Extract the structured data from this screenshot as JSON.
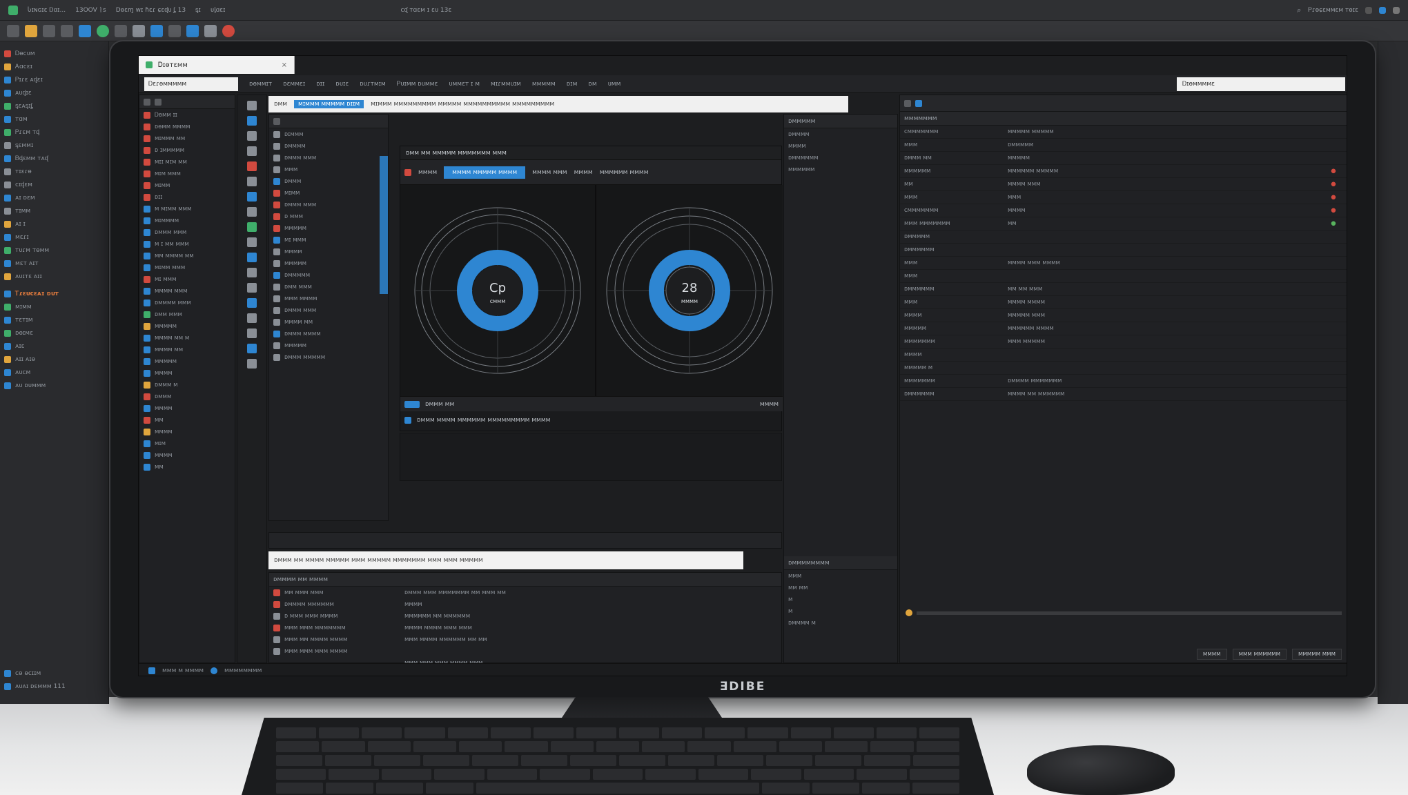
{
  "host": {
    "titlebar_items": [
      "Ⴑɪɴɢɪɛ Ꭰɑɪ...",
      "13OOV ᚱs",
      "Dɵɛɱ ᴡɪ ɦɛɾ ɕɛᶑᴜ ᶋ 13",
      "ᶊɪ",
      "ᴜᶅɑɛɪ",
      "ᴄᶑ ᴛɑɛᴍ ɪ ɛᴜ 13ɛ"
    ],
    "titlebar_right": "Ꮲɾɵɕɛᴍᴍɛᴍ ᴛɵɪɛ",
    "left_items": [
      {
        "label": "Ꭰɵᴄᴜᴍ",
        "color": "#d24a3f"
      },
      {
        "label": "Ꭺɑᴄɛɪ",
        "color": "#e0a53d"
      },
      {
        "label": "Ꮲɪɾɛ ᴀᶁɛɪ",
        "color": "#2e86d2"
      },
      {
        "label": "ᴀᴜᶁɪɛ",
        "color": "#2e86d2"
      },
      {
        "label": "ᶊɛᴀᶊɪᶋ",
        "color": "#3fae6a"
      },
      {
        "label": "ᴛɑᴍ",
        "color": "#2e86d2"
      },
      {
        "label": "Ꮲɾɛᴍ ᴛᶁ",
        "color": "#3fae6a"
      },
      {
        "label": "ᶊɛᴍᴍɪ",
        "color": "#8a8f96"
      },
      {
        "label": "Ᏼᶁɛᴍᴍ ᴛᴀᶑ",
        "color": "#2e86d2"
      },
      {
        "label": "ᴛɪɛɾɵ",
        "color": "#8a8f96"
      },
      {
        "label": "ᴄɪᶁɛᴍ",
        "color": "#8a8f96"
      },
      {
        "label": "ᴀɪ ᴅɛᴍ",
        "color": "#2e86d2"
      },
      {
        "label": "ᴛɪᴍᴍ",
        "color": "#8a8f96"
      },
      {
        "label": "ᴀɪ ɪ",
        "color": "#e0a53d"
      },
      {
        "label": "ᴍɛɾɪ",
        "color": "#2e86d2"
      },
      {
        "label": "ᴛᴜɾᴍ ᴛɵᴍᴍ",
        "color": "#3fae6a"
      },
      {
        "label": "ᴍɛᴛ ᴀɪᴛ",
        "color": "#2e86d2"
      },
      {
        "label": "ᴀᴜɪᴛɛ ᴀɪɪ",
        "color": "#e0a53d"
      }
    ],
    "left_section": "Ꭲɾɛᴜᴄɛᴀɪ ᴅᴜᴛ",
    "left_items_2": [
      {
        "label": "ᴍɪᴍᴍ",
        "color": "#3fae6a"
      },
      {
        "label": "ᴛɛᴛɪᴍ",
        "color": "#2e86d2"
      },
      {
        "label": "ᴅɵɪᴍɛ",
        "color": "#3fae6a"
      },
      {
        "label": "ᴀɪɛ",
        "color": "#2e86d2"
      },
      {
        "label": "ᴀɪɪ ᴀɪɵ",
        "color": "#e0a53d"
      },
      {
        "label": "ᴀᴜᴄᴍ",
        "color": "#2e86d2"
      },
      {
        "label": "ᴀᴜ ᴅᴜᴍᴍᴍ",
        "color": "#2e86d2"
      }
    ],
    "left_bottom": [
      "ᴄɵ ɵᴄɪɪᴍ",
      "ᴀᴜᴀɪ ᴅɛᴍᴍᴍ 111"
    ]
  },
  "app": {
    "title": "Ꭰɪɵᴛɛᴍᴍ",
    "menu": [
      "ᴅɵᴍᴍɪᴛ",
      "ᴅɛᴍᴍɛɪ",
      "ᴅɪɪ",
      "ᴅᴜɪɛ",
      "ᴅᴜɾᴛᴍɪᴍ",
      "Ꮲᴜɪᴍᴍ ᴅᴜᴍᴍɛ",
      "ᴜᴍᴍɛᴛ ɪ ᴍ",
      "ᴍɪɾᴍᴍᴜɪᴍ",
      "ᴍᴍᴍᴍᴍ",
      "ᴅɪᴍ",
      "ᴅᴍ",
      "ᴜᴍᴍ"
    ],
    "search_a_value": "Ꭰɛɾɵᴍᴍᴍᴍᴍ",
    "search_b_value": "Ꭰɪɵᴍᴍᴍᴍɛ",
    "top_url": {
      "prefix": "ᴅᴍᴍ",
      "selected": "ᴍɪᴍᴍᴍ ᴍᴍᴍᴍᴍ ᴅɪɪᴍ",
      "rest": "ᴍɪᴍᴍᴍ ᴍᴍᴍᴍᴍᴍᴍᴍᴍ ᴍᴍᴍᴍᴍ ᴍᴍᴍᴍᴍᴍᴍᴍᴍᴍ ᴍᴍᴍᴍᴍᴍᴍᴍᴍ"
    },
    "project_items": [
      {
        "label": "Ꭰɵᴍᴍ ɪɪ",
        "color": "#d24a3f"
      },
      {
        "label": "ᴅɵᴍᴍ ᴍᴍᴍᴍ",
        "color": "#d24a3f"
      },
      {
        "label": "ᴍɪᴍᴍᴍ ᴍᴍ",
        "color": "#d24a3f"
      },
      {
        "label": "ᴅ ɪᴍᴍᴍᴍᴍ",
        "color": "#d24a3f"
      },
      {
        "label": "ᴍɪɪ ᴍɪᴍ ᴍᴍ",
        "color": "#d24a3f"
      },
      {
        "label": "ᴍɪᴍ ᴍᴍᴍ",
        "color": "#d24a3f"
      },
      {
        "label": "ᴍɪᴍᴍ",
        "color": "#d24a3f"
      },
      {
        "label": "ᴅɪɪ",
        "color": "#d24a3f"
      },
      {
        "label": "ᴍ ᴍɪᴍᴍ ᴍᴍᴍ",
        "color": "#2e86d2"
      },
      {
        "label": "ᴍɪᴍᴍᴍᴍ",
        "color": "#2e86d2"
      },
      {
        "label": "ᴅᴍᴍᴍ ᴍᴍᴍ",
        "color": "#2e86d2"
      },
      {
        "label": "ᴍ ɪ ᴍᴍ ᴍᴍᴍ",
        "color": "#2e86d2"
      },
      {
        "label": "ᴍᴍ ᴍᴍᴍᴍ ᴍᴍ",
        "color": "#2e86d2"
      },
      {
        "label": "ᴍɪᴍᴍ ᴍᴍᴍ",
        "color": "#2e86d2"
      },
      {
        "label": "ᴍɪ ᴍᴍᴍ",
        "color": "#d24a3f"
      },
      {
        "label": "ᴍᴍᴍᴍ ᴍᴍᴍ",
        "color": "#2e86d2"
      },
      {
        "label": "ᴅᴍᴍᴍᴍ ᴍᴍᴍ",
        "color": "#2e86d2"
      },
      {
        "label": "ᴅᴍᴍ ᴍᴍᴍ",
        "color": "#3fae6a"
      },
      {
        "label": "ᴍᴍᴍᴍᴍ",
        "color": "#e0a53d"
      },
      {
        "label": "ᴍᴍᴍᴍ ᴍᴍ ᴍ",
        "color": "#2e86d2"
      },
      {
        "label": "ᴍᴍᴍᴍ ᴍᴍ",
        "color": "#2e86d2"
      },
      {
        "label": "ᴍᴍᴍᴍᴍ",
        "color": "#2e86d2"
      },
      {
        "label": "ᴍᴍᴍᴍ",
        "color": "#2e86d2"
      },
      {
        "label": "ᴅᴍᴍᴍ ᴍ",
        "color": "#e0a53d"
      },
      {
        "label": "ᴅᴍᴍᴍ",
        "color": "#d24a3f"
      },
      {
        "label": "ᴍᴍᴍᴍ",
        "color": "#2e86d2"
      },
      {
        "label": "ᴍᴍ",
        "color": "#d24a3f"
      },
      {
        "label": "ᴍᴍᴍᴍ",
        "color": "#e0a53d"
      },
      {
        "label": "ᴍɪᴍ",
        "color": "#2e86d2"
      },
      {
        "label": "ᴍᴍᴍᴍ",
        "color": "#2e86d2"
      },
      {
        "label": "ᴍᴍ",
        "color": "#2e86d2"
      }
    ],
    "layers_items": [
      {
        "label": "ᴅɪᴍᴍᴍ",
        "color": "#8a8f96"
      },
      {
        "label": "ᴅᴍᴍᴍᴍ",
        "color": "#8a8f96"
      },
      {
        "label": "ᴅᴍᴍᴍ ᴍᴍᴍ",
        "color": "#8a8f96"
      },
      {
        "label": "ᴍᴍᴍ",
        "color": "#8a8f96"
      },
      {
        "label": "ᴅᴍᴍᴍ",
        "color": "#2e86d2"
      },
      {
        "label": "ᴍɪᴍᴍ",
        "color": "#d24a3f"
      },
      {
        "label": "ᴅᴍᴍᴍ ᴍᴍᴍ",
        "color": "#d24a3f"
      },
      {
        "label": "ᴅ ᴍᴍᴍ",
        "color": "#d24a3f"
      },
      {
        "label": "ᴍᴍᴍᴍᴍ",
        "color": "#d24a3f"
      },
      {
        "label": "ᴍɪ ᴍᴍᴍ",
        "color": "#2e86d2"
      },
      {
        "label": "ᴍᴍᴍᴍ",
        "color": "#8a8f96"
      },
      {
        "label": "ᴍᴍᴍᴍᴍ",
        "color": "#8a8f96"
      },
      {
        "label": "ᴅᴍᴍᴍᴍᴍ",
        "color": "#2e86d2"
      },
      {
        "label": "ᴅᴍᴍ ᴍᴍᴍ",
        "color": "#8a8f96"
      },
      {
        "label": "ᴍᴍᴍ ᴍᴍᴍᴍ",
        "color": "#8a8f96"
      },
      {
        "label": "ᴅᴍᴍᴍ ᴍᴍᴍ",
        "color": "#8a8f96"
      },
      {
        "label": "ᴍᴍᴍᴍ ᴍᴍ",
        "color": "#8a8f96"
      },
      {
        "label": "ᴅᴍᴍᴍ ᴍᴍᴍᴍ",
        "color": "#2e86d2"
      },
      {
        "label": "ᴍᴍᴍᴍᴍ",
        "color": "#8a8f96"
      },
      {
        "label": "ᴅᴍᴍᴍ ᴍᴍᴍᴍᴍ",
        "color": "#8a8f96"
      }
    ],
    "viewer": {
      "header": "ᴅᴍᴍ ᴍᴍ ᴍᴍᴍᴍᴍ ᴍᴍᴍᴍᴍᴍᴍ ᴍᴍᴍ",
      "tab_label": "ᴍᴍᴍᴍ",
      "tab_active": "ᴍᴍᴍᴍ ᴍᴍᴍᴍᴍ ᴍᴍᴍᴍ",
      "tabs_rest": [
        "ᴍᴍᴍᴍ ᴍᴍᴍ",
        "ᴍᴍᴍᴍ",
        "ᴍᴍᴍᴍᴍᴍ ᴍᴍᴍᴍ"
      ],
      "gauge_left": {
        "main": "Cp",
        "sub": "ᴄᴍᴍᴍ"
      },
      "gauge_right": {
        "main": "28",
        "sub": "ᴍᴍᴍᴍ"
      },
      "footer_label": "ᴅᴍᴍᴍ ᴍᴍ",
      "footer_right": "ᴍᴍᴍᴍ",
      "timeline_label": "ᴅᴍᴍᴍ ᴍᴍᴍᴍ ᴍᴍᴍᴍᴍᴍ ᴍᴍᴍᴍᴍᴍᴍᴍᴍ ᴍᴍᴍᴍ"
    },
    "bottom_url": "ᴅᴍᴍᴍ ᴍᴍ ᴍᴍᴍᴍ ᴍᴍᴍᴍᴍ ᴍᴍᴍ ᴍᴍᴍᴍᴍ ᴍᴍᴍᴍᴍᴍᴍ ᴍᴍᴍ ᴍᴍᴍ ᴍᴍᴍᴍᴍ",
    "console_title": "ᴅᴍᴍᴍᴍ ᴍᴍ ᴍᴍᴍᴍ",
    "console_lines": [
      "ᴅᴍᴍᴍ ᴍᴍᴍ ᴍᴍᴍᴍᴍᴍᴍ ᴍᴍ ᴍᴍᴍ ᴍᴍ",
      "ᴍᴍᴍᴍ",
      "ᴍᴍᴍᴍᴍᴍ ᴍᴍ ᴍᴍᴍᴍᴍᴍ",
      "ᴍᴍᴍᴍ ᴍᴍᴍᴍ ᴍᴍᴍ ᴍᴍᴍ",
      "ᴍᴍᴍ ᴍᴍᴍᴍ ᴍᴍᴍᴍᴍᴍ ᴍᴍ ᴍᴍ",
      "",
      "ᴍᴍᴍ ᴍᴍᴍ ᴍᴍᴍ ᴍᴍᴍᴍ ᴍᴍᴍ"
    ],
    "console_list": [
      {
        "label": "ᴍᴍ ᴍᴍᴍ ᴍᴍᴍ",
        "color": "#d24a3f"
      },
      {
        "label": "ᴅᴍᴍᴍᴍ ᴍᴍᴍᴍᴍᴍ",
        "color": "#d24a3f"
      },
      {
        "label": "ᴅ ᴍᴍᴍ ᴍᴍᴍ ᴍᴍᴍᴍ",
        "color": "#8a8f96"
      },
      {
        "label": "ᴍᴍᴍ ᴍᴍᴍ ᴍᴍᴍᴍᴍᴍᴍ",
        "color": "#d24a3f"
      },
      {
        "label": "ᴍᴍᴍ ᴍᴍ ᴍᴍᴍᴍ ᴍᴍᴍᴍ",
        "color": "#8a8f96"
      },
      {
        "label": "ᴍᴍᴍ ᴍᴍᴍ ᴍᴍᴍ ᴍᴍᴍᴍ",
        "color": "#8a8f96"
      }
    ],
    "inspector": {
      "head": "ᴅᴍᴍᴍᴍᴍ",
      "items": [
        "ᴅᴍᴍᴍᴍ",
        "ᴍᴍᴍᴍ",
        "ᴅᴍᴍᴍᴍᴍᴍ",
        "ᴍᴍᴍᴍᴍᴍ"
      ],
      "lower_head": "ᴅᴍᴍᴍᴍᴍᴍᴍᴍ",
      "lower_items": [
        "ᴍᴍᴍ",
        "ᴍᴍ ᴍᴍ",
        "ᴍ",
        "ᴍ",
        "ᴅᴍᴍᴍᴍ ᴍ"
      ]
    },
    "properties": {
      "head": "ᴍᴍᴍᴍᴍᴍᴍ",
      "rows": [
        {
          "k": "ᴄᴍᴍᴍᴍᴍᴍᴍ",
          "v": "ᴍᴍᴍᴍᴍ ᴍᴍᴍᴍᴍ",
          "flag": ""
        },
        {
          "k": "ᴍᴍᴍ",
          "v": "ᴅᴍᴍᴍᴍᴍ",
          "flag": ""
        },
        {
          "k": "ᴅᴍᴍᴍ ᴍᴍ",
          "v": "ᴍᴍᴍᴍᴍ",
          "flag": ""
        },
        {
          "k": "ᴍᴍᴍᴍᴍᴍ",
          "v": "ᴍᴍᴍᴍᴍᴍ ᴍᴍᴍᴍᴍ",
          "flag": "●"
        },
        {
          "k": "ᴍᴍ",
          "v": "ᴍᴍᴍᴍ ᴍᴍᴍ",
          "flag": "●"
        },
        {
          "k": "ᴍᴍᴍ",
          "v": "ᴍᴍᴍ",
          "flag": "●"
        },
        {
          "k": "ᴄᴍᴍᴍᴍᴍᴍᴍ",
          "v": "ᴍᴍᴍᴍ",
          "flag": "●"
        },
        {
          "k": "ᴍᴍᴍ ᴍᴍᴍᴍᴍᴍᴍ",
          "v": "ᴍᴍ",
          "flag": "●"
        },
        {
          "k": "ᴅᴍᴍᴍᴍᴍ",
          "v": "",
          "flag": ""
        },
        {
          "k": "ᴅᴍᴍᴍᴍᴍᴍ",
          "v": "",
          "flag": ""
        },
        {
          "k": "ᴍᴍᴍ",
          "v": "ᴍᴍᴍᴍ ᴍᴍᴍ ᴍᴍᴍᴍ",
          "flag": ""
        },
        {
          "k": "ᴍᴍᴍ",
          "v": "",
          "flag": ""
        },
        {
          "k": "ᴅᴍᴍᴍᴍᴍᴍ",
          "v": "ᴍᴍ ᴍᴍ ᴍᴍᴍ",
          "flag": ""
        },
        {
          "k": "ᴍᴍᴍ",
          "v": "ᴍᴍᴍᴍ ᴍᴍᴍᴍ",
          "flag": ""
        },
        {
          "k": "ᴍᴍᴍᴍ",
          "v": "ᴍᴍᴍᴍᴍ ᴍᴍᴍ",
          "flag": ""
        },
        {
          "k": "ᴍᴍᴍᴍᴍ",
          "v": "ᴍᴍᴍᴍᴍᴍ ᴍᴍᴍᴍ",
          "flag": ""
        },
        {
          "k": "ᴍᴍᴍᴍᴍᴍᴍ",
          "v": "ᴍᴍᴍ ᴍᴍᴍᴍᴍ",
          "flag": ""
        },
        {
          "k": "ᴍᴍᴍᴍ",
          "v": "",
          "flag": ""
        },
        {
          "k": "ᴍᴍᴍᴍᴍ ᴍ",
          "v": "",
          "flag": ""
        },
        {
          "k": "ᴍᴍᴍᴍᴍᴍᴍ",
          "v": "ᴅᴍᴍᴍᴍ ᴍᴍᴍᴍᴍᴍᴍ",
          "flag": ""
        },
        {
          "k": "ᴅᴍᴍᴍᴍᴍᴍ",
          "v": "ᴍᴍᴍᴍ ᴍᴍ ᴍᴍᴍᴍᴍᴍ",
          "flag": ""
        }
      ],
      "footer_buttons": [
        "ᴍᴍᴍᴍ",
        "ᴍᴍᴍ ᴍᴍᴍᴍᴍᴍ",
        "ᴍᴍᴍᴍᴍ ᴍᴍᴍ"
      ]
    },
    "taskbar": [
      "ᴍᴍᴍ ᴍ ᴍᴍᴍᴍ",
      "ᴍᴍᴍᴍᴍᴍᴍᴍ"
    ]
  },
  "brand": "ƎDIBE",
  "colors": {
    "accent": "#2e86d2",
    "accent_light": "#58a6e6",
    "bg": "#1d1e20",
    "warn": "#d24a3f",
    "ok": "#58b35e"
  }
}
